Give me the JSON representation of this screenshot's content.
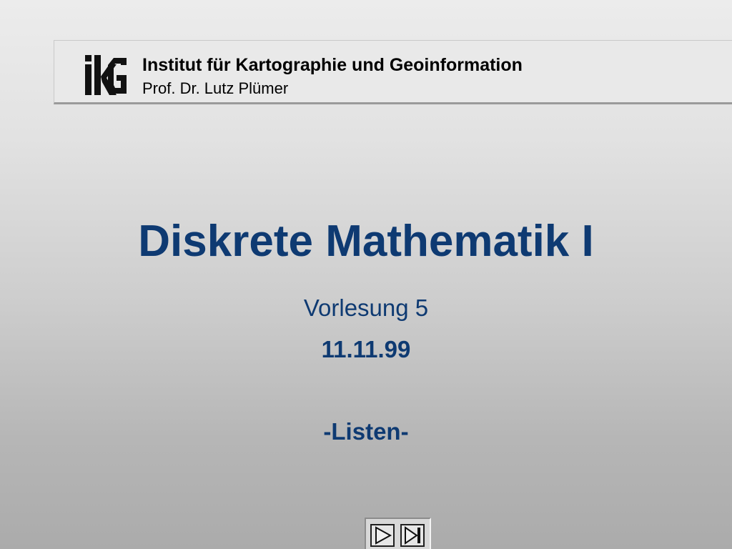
{
  "header": {
    "logo_label": "IKG",
    "institute": "Institut für Kartographie und Geoinformation",
    "professor": "Prof. Dr. Lutz Plümer"
  },
  "slide": {
    "title": "Diskrete Mathematik I",
    "lecture": "Vorlesung 5",
    "date": "11.11.99",
    "topic": "-Listen-"
  },
  "navigation": {
    "buttons": [
      {
        "icon": "play-next-icon"
      },
      {
        "icon": "skip-to-end-icon"
      }
    ]
  },
  "colors": {
    "title": "#0e3a72",
    "header_text": "#000000",
    "header_background": "#e9e9e9"
  }
}
